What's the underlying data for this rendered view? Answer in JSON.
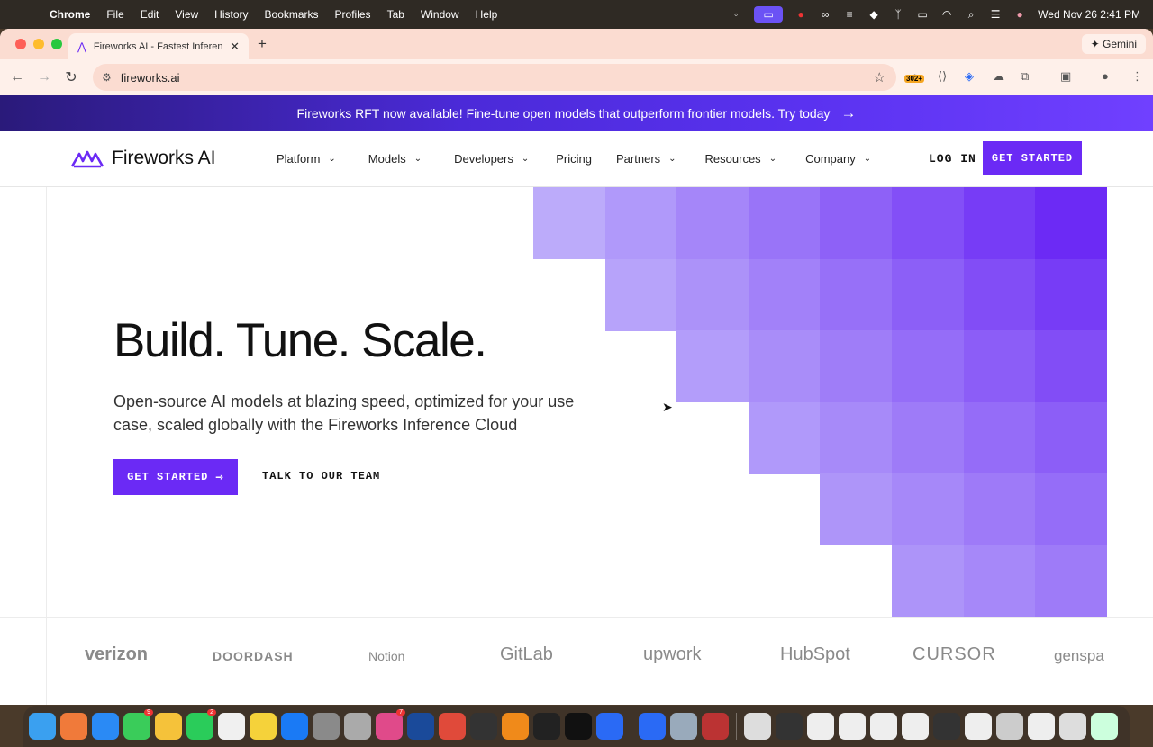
{
  "menubar": {
    "app": "Chrome",
    "items": [
      "File",
      "Edit",
      "View",
      "History",
      "Bookmarks",
      "Profiles",
      "Tab",
      "Window",
      "Help"
    ],
    "datetime": "Wed Nov 26  2:41 PM"
  },
  "browser": {
    "tab_title": "Fireworks AI - Fastest Inferen",
    "gemini_label": "Gemini",
    "url": "fireworks.ai",
    "extension_badge": "302+"
  },
  "banner": {
    "text": "Fireworks RFT now available! Fine-tune open models that outperform frontier models. Try today"
  },
  "header": {
    "logo_text": "Fireworks AI",
    "nav": [
      {
        "label": "Platform",
        "dropdown": true
      },
      {
        "label": "Models",
        "dropdown": true
      },
      {
        "label": "Developers",
        "dropdown": true
      },
      {
        "label": "Pricing",
        "dropdown": false
      },
      {
        "label": "Partners",
        "dropdown": true
      },
      {
        "label": "Resources",
        "dropdown": true
      },
      {
        "label": "Company",
        "dropdown": true
      }
    ],
    "login_label": "LOG IN",
    "cta_label": "GET STARTED"
  },
  "hero": {
    "headline": "Build. Tune. Scale.",
    "subtext": "Open-source AI models at blazing speed, optimized for your use case, scaled globally with the Fireworks Inference Cloud",
    "primary_cta": "GET STARTED",
    "secondary_cta": "TALK TO OUR TEAM"
  },
  "customers": [
    "verizon",
    "DOORDASH",
    "Notion",
    "GitLab",
    "upwork",
    "HubSpot",
    "CURSOR",
    "genspa"
  ],
  "colors": {
    "brand": "#6b2af5",
    "banner_start": "#2a1a7a",
    "banner_end": "#7040ff"
  }
}
